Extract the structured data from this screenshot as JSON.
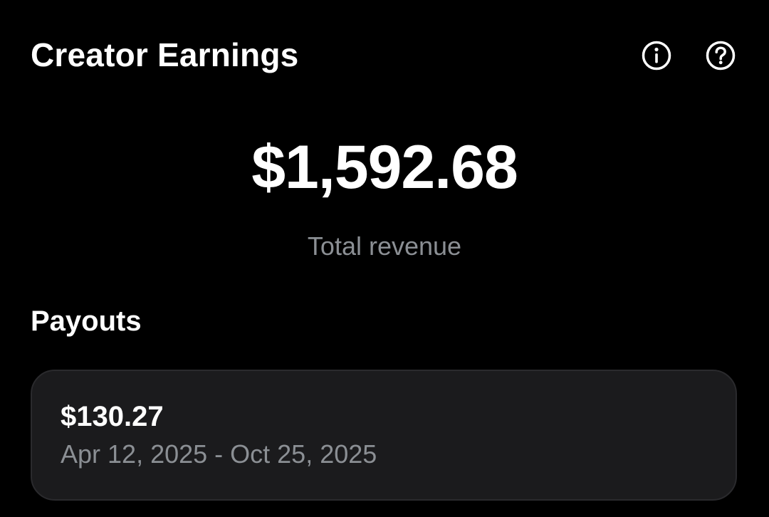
{
  "header": {
    "title": "Creator Earnings",
    "info_icon": "info-circle-icon",
    "help_icon": "question-circle-icon"
  },
  "revenue": {
    "amount": "$1,592.68",
    "label": "Total revenue"
  },
  "payouts": {
    "title": "Payouts",
    "items": [
      {
        "amount": "$130.27",
        "period": "Apr 12, 2025 - Oct 25, 2025"
      }
    ]
  },
  "colors": {
    "background": "#000000",
    "primary_text": "#ffffff",
    "secondary_text": "#8b8f94",
    "card_background": "#1b1b1d",
    "card_border": "#2a2a2d"
  }
}
